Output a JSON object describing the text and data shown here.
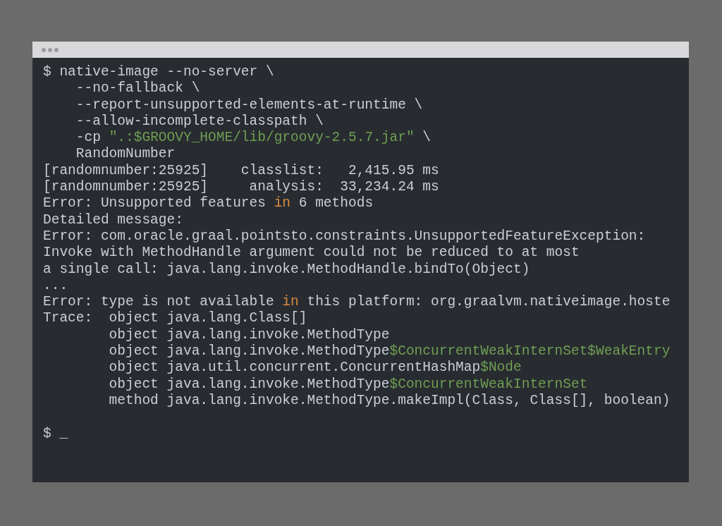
{
  "terminal": {
    "lines": [
      {
        "kind": "text",
        "segments": [
          {
            "text": "$ native-image --no-server \\",
            "kind": "plain"
          }
        ]
      },
      {
        "kind": "text",
        "segments": [
          {
            "text": "    --no-fallback \\",
            "kind": "plain"
          }
        ]
      },
      {
        "kind": "text",
        "segments": [
          {
            "text": "    --report-unsupported-elements-at-runtime \\",
            "kind": "plain"
          }
        ]
      },
      {
        "kind": "text",
        "segments": [
          {
            "text": "    --allow-incomplete-classpath \\",
            "kind": "plain"
          }
        ]
      },
      {
        "kind": "text",
        "segments": [
          {
            "text": "    -cp ",
            "kind": "plain"
          },
          {
            "text": "\".:$GROOVY_HOME/lib/groovy-2.5.7.jar\"",
            "kind": "string"
          },
          {
            "text": " \\",
            "kind": "plain"
          }
        ]
      },
      {
        "kind": "text",
        "segments": [
          {
            "text": "    RandomNumber",
            "kind": "plain"
          }
        ]
      },
      {
        "kind": "text",
        "segments": [
          {
            "text": "[randomnumber:25925]    classlist:   2,415.95 ms",
            "kind": "plain"
          }
        ]
      },
      {
        "kind": "text",
        "segments": [
          {
            "text": "[randomnumber:25925]     analysis:  33,234.24 ms",
            "kind": "plain"
          }
        ]
      },
      {
        "kind": "text",
        "segments": [
          {
            "text": "Error: Unsupported features ",
            "kind": "plain"
          },
          {
            "text": "in",
            "kind": "keyword"
          },
          {
            "text": " 6 methods",
            "kind": "plain"
          }
        ]
      },
      {
        "kind": "text",
        "segments": [
          {
            "text": "Detailed message:",
            "kind": "plain"
          }
        ]
      },
      {
        "kind": "text",
        "segments": [
          {
            "text": "Error: com.oracle.graal.pointsto.constraints.UnsupportedFeatureException:",
            "kind": "plain"
          }
        ]
      },
      {
        "kind": "text",
        "segments": [
          {
            "text": "Invoke with MethodHandle argument could not be reduced to at most",
            "kind": "plain"
          }
        ]
      },
      {
        "kind": "text",
        "segments": [
          {
            "text": "a single call: java.lang.invoke.MethodHandle.bindTo(Object)",
            "kind": "plain"
          }
        ]
      },
      {
        "kind": "text",
        "segments": [
          {
            "text": "...",
            "kind": "plain"
          }
        ]
      },
      {
        "kind": "text",
        "segments": [
          {
            "text": "Error: type is not available ",
            "kind": "plain"
          },
          {
            "text": "in",
            "kind": "keyword"
          },
          {
            "text": " this platform: org.graalvm.nativeimage.hoste",
            "kind": "plain"
          }
        ]
      },
      {
        "kind": "text",
        "segments": [
          {
            "text": "Trace:  object java.lang.Class[]",
            "kind": "plain"
          }
        ]
      },
      {
        "kind": "text",
        "segments": [
          {
            "text": "        object java.lang.invoke.MethodType",
            "kind": "plain"
          }
        ]
      },
      {
        "kind": "text",
        "segments": [
          {
            "text": "        object java.lang.invoke.MethodType",
            "kind": "plain"
          },
          {
            "text": "$ConcurrentWeakInternSet$WeakEntry",
            "kind": "string"
          }
        ]
      },
      {
        "kind": "text",
        "segments": [
          {
            "text": "        object java.util.concurrent.ConcurrentHashMap",
            "kind": "plain"
          },
          {
            "text": "$Node",
            "kind": "string"
          }
        ]
      },
      {
        "kind": "text",
        "segments": [
          {
            "text": "        object java.lang.invoke.MethodType",
            "kind": "plain"
          },
          {
            "text": "$ConcurrentWeakInternSet",
            "kind": "string"
          }
        ]
      },
      {
        "kind": "text",
        "segments": [
          {
            "text": "        method java.lang.invoke.MethodType.makeImpl(Class, Class[], boolean)",
            "kind": "plain"
          }
        ]
      },
      {
        "kind": "blank"
      },
      {
        "kind": "text",
        "segments": [
          {
            "text": "$ _",
            "kind": "plain"
          }
        ]
      }
    ]
  }
}
